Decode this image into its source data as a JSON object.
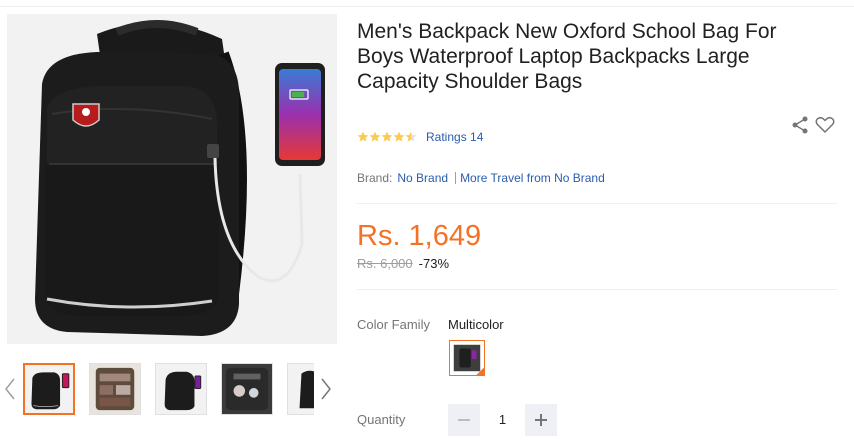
{
  "product": {
    "title": "Men's Backpack New Oxford School Bag For Boys Waterproof Laptop Backpacks Large Capacity Shoulder Bags",
    "image_icon": "backpack-with-phone-image",
    "rating_stars": 4.5,
    "ratings_label": "Ratings 14",
    "brand_label": "Brand:",
    "brand_name": "No Brand",
    "more_link": "More Travel from No Brand",
    "price": "Rs. 1,649",
    "original_price": "Rs. 6,000",
    "discount": "-73%",
    "color_family_label": "Color Family",
    "color_family_value": "Multicolor",
    "quantity_label": "Quantity",
    "quantity_value": "1"
  },
  "thumbnails": [
    {
      "icon": "black-backpack-phone-thumbnail",
      "active": true
    },
    {
      "icon": "backpack-interior-thumbnail",
      "active": false
    },
    {
      "icon": "black-backpack-thumbnail",
      "active": false
    },
    {
      "icon": "backpack-compartment-thumbnail",
      "active": false
    },
    {
      "icon": "backpack-side-thumbnail",
      "active": false
    }
  ],
  "colors": {
    "accent": "#f57224",
    "link": "#2a5db0",
    "star": "#faca51",
    "muted": "#757575"
  },
  "icons": {
    "share": "share-icon",
    "wishlist": "heart-icon",
    "prev": "chevron-left-icon",
    "next": "chevron-right-icon",
    "minus": "minus-icon",
    "plus": "plus-icon"
  }
}
